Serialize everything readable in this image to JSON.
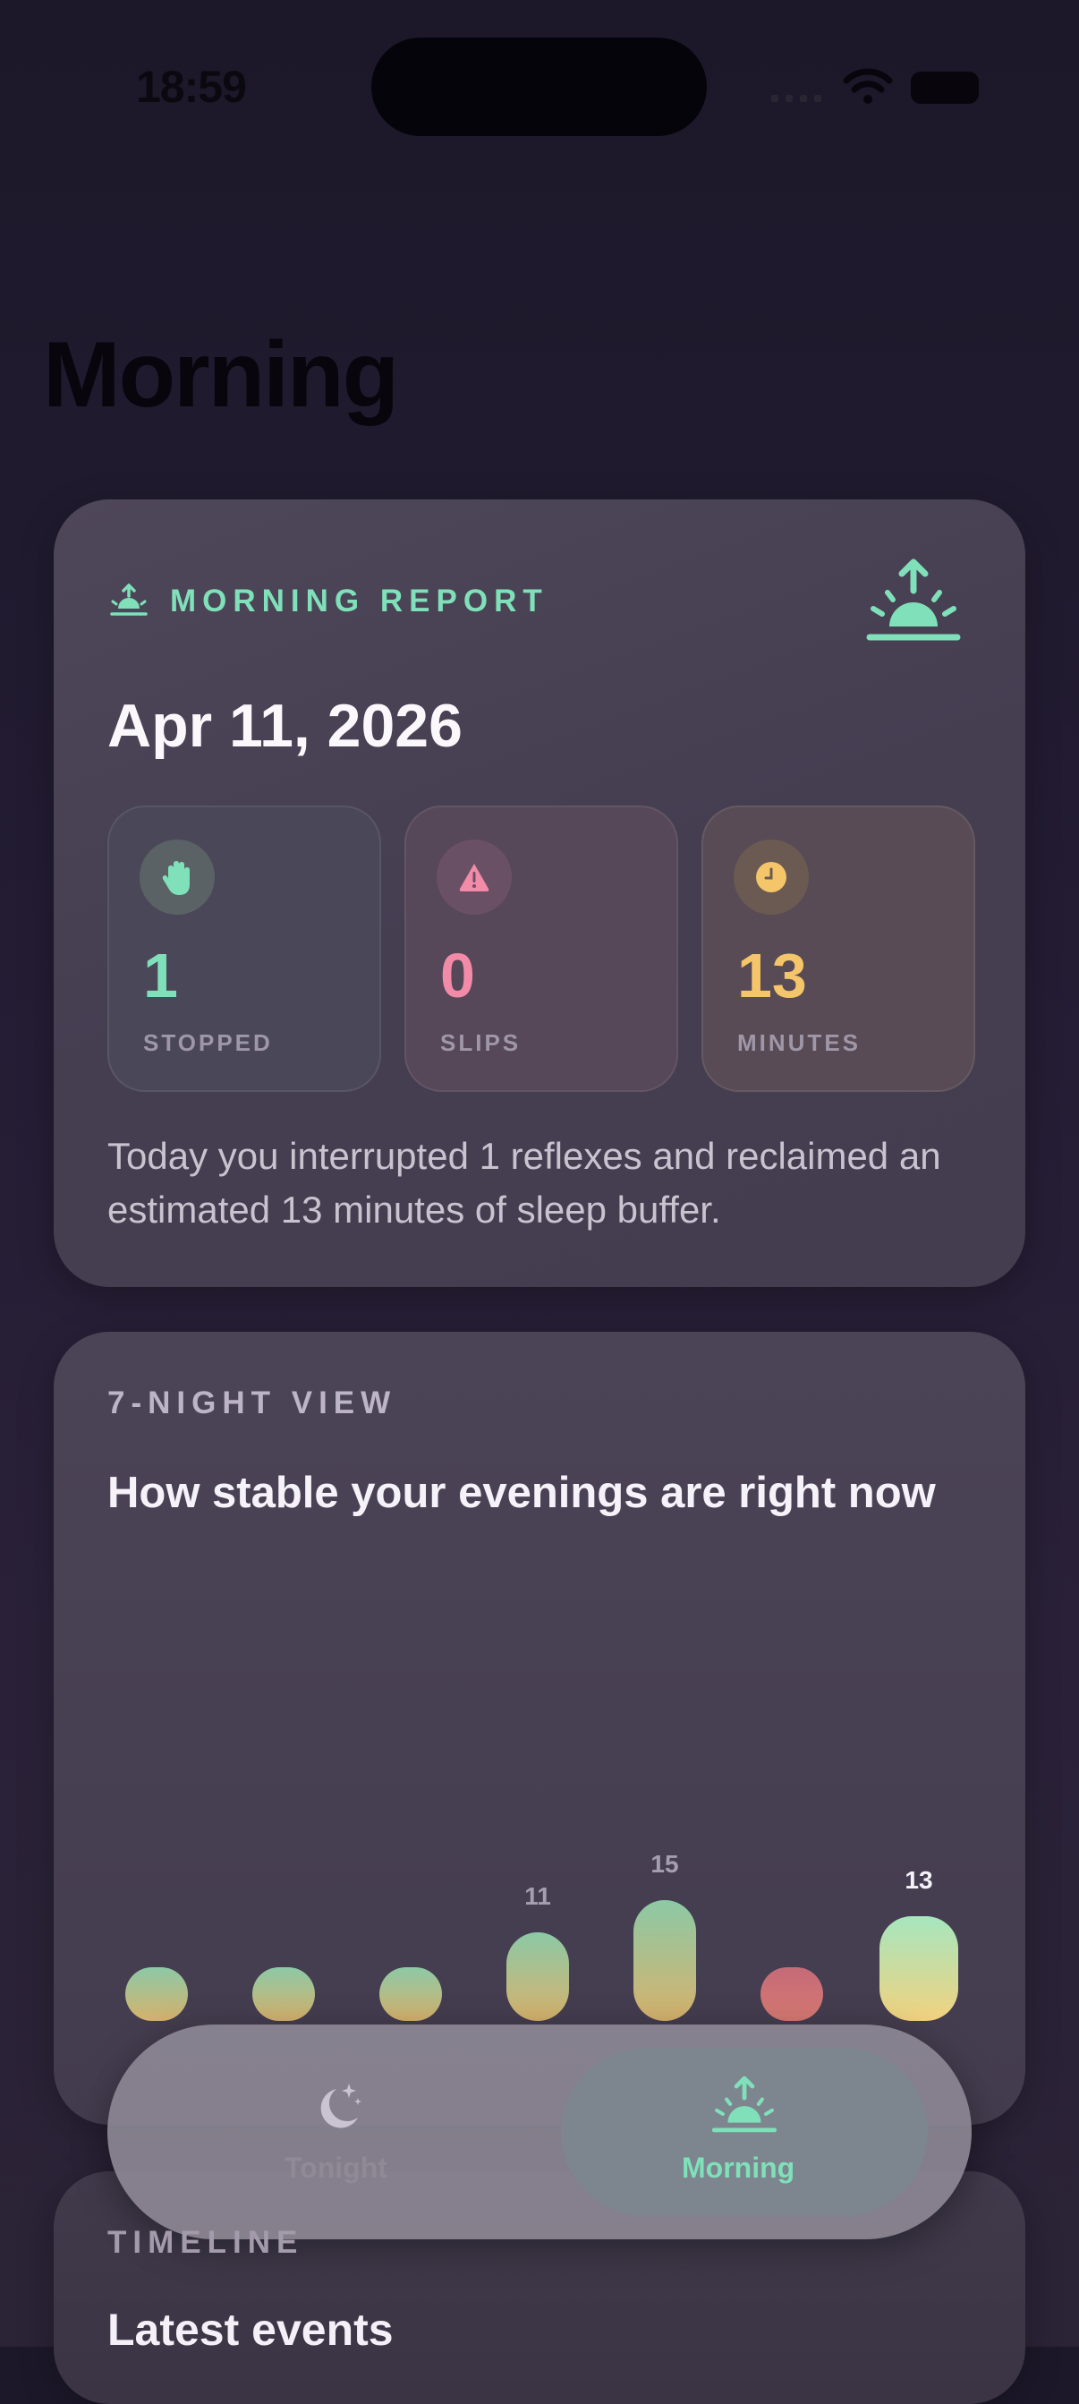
{
  "status_bar": {
    "time": "18:59"
  },
  "page": {
    "title": "Morning"
  },
  "report": {
    "eyebrow": "MORNING REPORT",
    "date": "Apr 11, 2026",
    "stats": [
      {
        "value": "1",
        "label": "STOPPED",
        "icon": "hand-raised-icon",
        "color": "#7fe0b9"
      },
      {
        "value": "0",
        "label": "SLIPS",
        "icon": "warning-triangle-icon",
        "color": "#f28ba8"
      },
      {
        "value": "13",
        "label": "MINUTES",
        "icon": "clock-icon",
        "color": "#f5c56a"
      }
    ],
    "summary": "Today you interrupted 1 reflexes and reclaimed an estimated 13 minutes of sleep buffer."
  },
  "seven_night": {
    "eyebrow": "7-NIGHT VIEW",
    "title": "How stable your evenings are right now"
  },
  "chart_data": {
    "type": "bar",
    "categories": [
      "",
      "",
      "",
      "",
      "",
      "",
      ""
    ],
    "values": [
      null,
      null,
      null,
      11,
      15,
      null,
      13
    ],
    "labels": [
      "",
      "",
      "",
      "11",
      "15",
      "",
      "13"
    ],
    "colors": [
      "gradient-green-amber",
      "gradient-green-amber",
      "gradient-green-amber",
      "gradient-green-amber",
      "gradient-green-amber",
      "gradient-red",
      "gradient-mint-yellow"
    ]
  },
  "tabbar": {
    "tabs": [
      {
        "label": "Tonight",
        "icon": "moon-stars-icon",
        "selected": false
      },
      {
        "label": "Morning",
        "icon": "sunrise-icon",
        "selected": true
      }
    ]
  },
  "timeline": {
    "eyebrow": "TIMELINE",
    "title": "Latest events"
  },
  "colors": {
    "accent": "#7fe0b9",
    "slip": "#f28ba8",
    "minutes": "#f5c56a"
  }
}
